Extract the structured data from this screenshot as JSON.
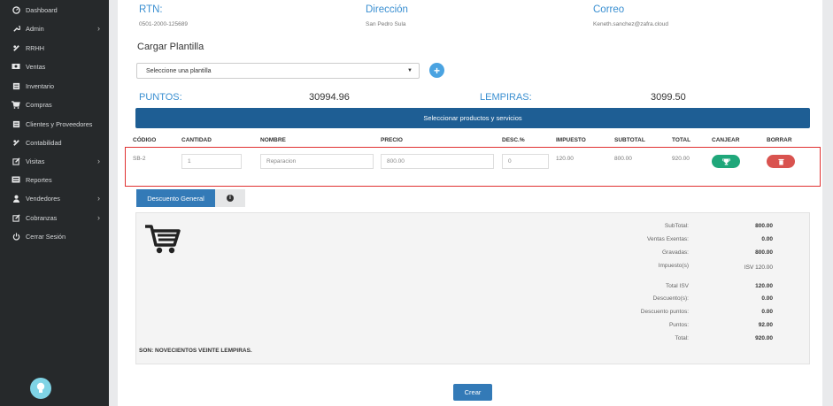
{
  "sidebar": {
    "items": [
      {
        "label": "Dashboard",
        "icon": "dashboard-icon",
        "chevron": false
      },
      {
        "label": "Admin",
        "icon": "wrench-icon",
        "chevron": true
      },
      {
        "label": "RRHH",
        "icon": "users-icon",
        "chevron": false
      },
      {
        "label": "Ventas",
        "icon": "money-icon",
        "chevron": false
      },
      {
        "label": "Inventario",
        "icon": "inventory-icon",
        "chevron": false
      },
      {
        "label": "Compras",
        "icon": "cart-icon",
        "chevron": false
      },
      {
        "label": "Clientes y Proveedores",
        "icon": "contacts-icon",
        "chevron": false
      },
      {
        "label": "Contabilidad",
        "icon": "link-icon",
        "chevron": false
      },
      {
        "label": "Visitas",
        "icon": "edit-icon",
        "chevron": true
      },
      {
        "label": "Reportes",
        "icon": "report-icon",
        "chevron": false
      },
      {
        "label": "Vendedores",
        "icon": "user-icon",
        "chevron": true
      },
      {
        "label": "Cobranzas",
        "icon": "edit-icon",
        "chevron": true
      },
      {
        "label": "Cerrar Sesión",
        "icon": "power-icon",
        "chevron": false
      }
    ]
  },
  "header": {
    "rtn_label": "RTN:",
    "rtn_value": "0501-2000-125689",
    "direccion_label": "Dirección",
    "direccion_value": "San Pedro Sula",
    "correo_label": "Correo",
    "correo_value": "Keneth.sanchez@zafra.cloud"
  },
  "plantilla": {
    "title": "Cargar Plantilla",
    "select_value": "Seleccione una plantilla",
    "add_label": "+"
  },
  "points": {
    "puntos_label": "PUNTOS:",
    "puntos_value": "30994.96",
    "lempiras_label": "LEMPIRAS:",
    "lempiras_value": "3099.50"
  },
  "select_products_label": "Seleccionar productos y servicios",
  "table": {
    "headers": [
      "CÓDIGO",
      "CANTIDAD",
      "NOMBRE",
      "PRECIO",
      "DESC.%",
      "IMPUESTO",
      "SUBTOTAL",
      "TOTAL",
      "CANJEAR",
      "BORRAR"
    ],
    "row": {
      "codigo": "SB-2",
      "cantidad": "1",
      "nombre": "Reparacion",
      "precio": "800.00",
      "desc": "0",
      "impuesto": "120.00",
      "subtotal": "800.00",
      "total": "920.00"
    }
  },
  "tabs": {
    "descuento_label": "Descuento General",
    "info_label": "i"
  },
  "summary": {
    "rows": [
      {
        "label": "SubTotal:",
        "value": "800.00"
      },
      {
        "label": "Ventas Exentas:",
        "value": "0.00"
      },
      {
        "label": "Gravadas:",
        "value": "800.00"
      },
      {
        "label": "Impuesto(s)",
        "value": "ISV 120.00"
      },
      {
        "label": "Total ISV",
        "value": "120.00"
      },
      {
        "label": "Descuento(s):",
        "value": "0.00"
      },
      {
        "label": "Descuento puntos:",
        "value": "0.00"
      },
      {
        "label": "Puntos:",
        "value": "92.00"
      },
      {
        "label": "Total:",
        "value": "920.00"
      }
    ],
    "son_text": "SON: NOVECIENTOS VEINTE LEMPIRAS."
  },
  "crear_label": "Crear",
  "colors": {
    "sidebar_bg": "#26292b",
    "accent_blue": "#3a8fd1",
    "bar_blue": "#1e5e94",
    "green": "#1fa77a",
    "red": "#d9534f"
  }
}
